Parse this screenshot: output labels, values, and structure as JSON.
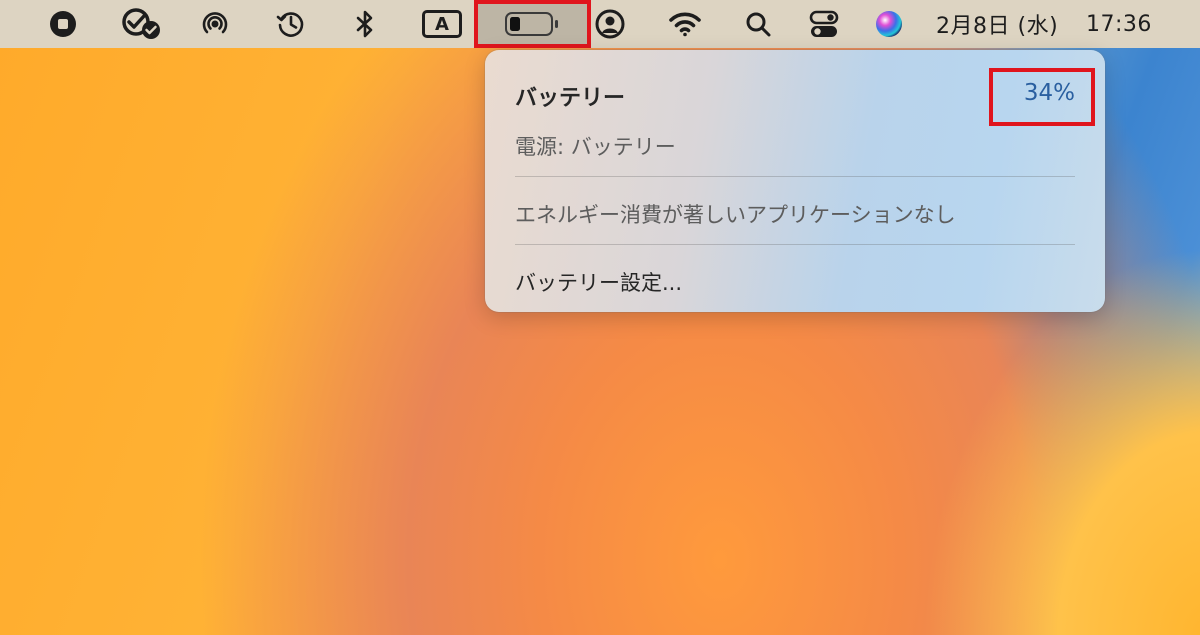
{
  "menubar": {
    "icons": [
      "stop-icon",
      "checkmark-badge-icon",
      "airdrop-icon",
      "time-machine-icon",
      "bluetooth-icon",
      "input-source-icon",
      "battery-icon",
      "user-icon",
      "wifi-icon",
      "search-icon",
      "control-center-icon",
      "siri-icon"
    ],
    "input_source_label": "A",
    "date": "2月8日 (水)",
    "time": "17:36",
    "battery_level": 0.25
  },
  "battery_menu": {
    "title": "バッテリー",
    "percent": "34%",
    "power_source": "電源: バッテリー",
    "energy_apps": "エネルギー消費が著しいアプリケーションなし",
    "settings": "バッテリー設定..."
  },
  "colors": {
    "highlight": "#e0151d",
    "percent_text": "#2a5fa0",
    "menubar": "#ddd4c2"
  }
}
